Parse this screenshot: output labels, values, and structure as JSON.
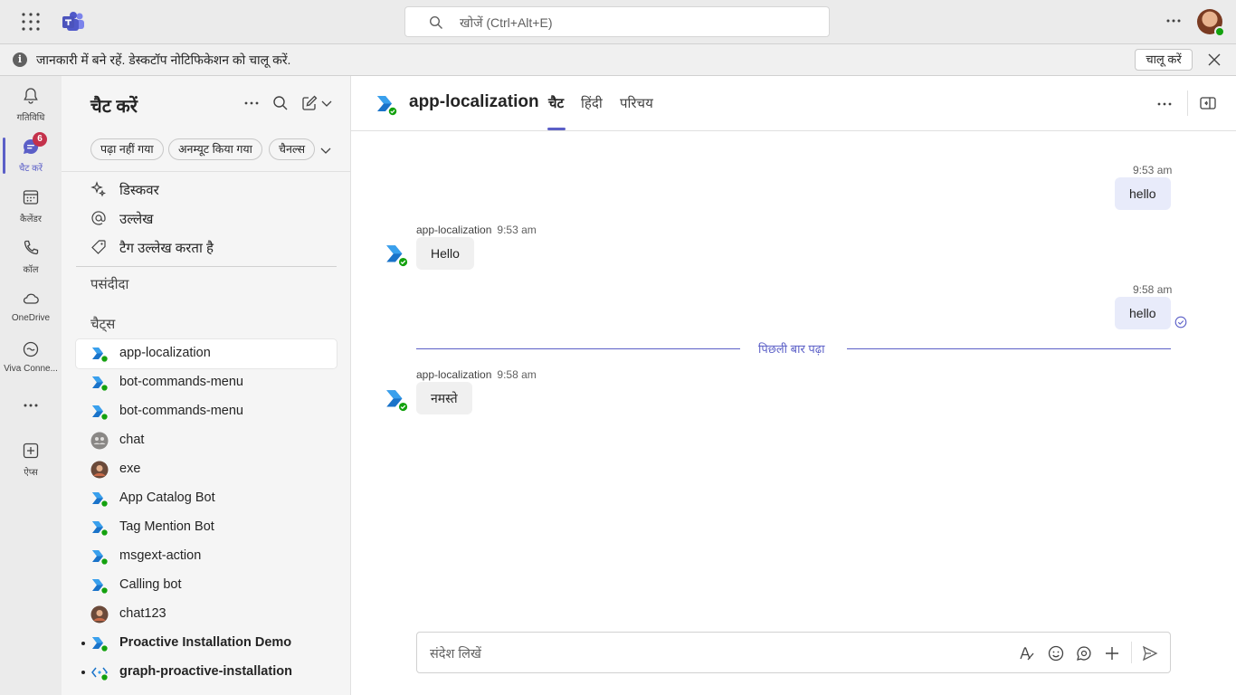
{
  "colors": {
    "brand": "#5b5fc7",
    "badge": "#c4314b",
    "presence": "#13a10e",
    "bubble_me": "#e8ebfa",
    "bubble_bot": "#f0f0f0"
  },
  "topbar": {
    "search_placeholder": "खोजें (Ctrl+Alt+E)"
  },
  "notification": {
    "text": "जानकारी में बने रहें. डेस्कटॉप नोटिफिकेशन को चालू करें.",
    "button": "चालू करें"
  },
  "rail": {
    "items": [
      {
        "label": "गतिविधि",
        "icon": "bell-icon"
      },
      {
        "label": "चैट करें",
        "icon": "chat-icon",
        "badge": "6"
      },
      {
        "label": "कैलेंडर",
        "icon": "calendar-icon"
      },
      {
        "label": "कॉल",
        "icon": "phone-icon"
      },
      {
        "label": "OneDrive",
        "icon": "cloud-icon"
      },
      {
        "label": "Viva Conne...",
        "icon": "viva-connections-icon"
      },
      {
        "label": "ऐप्स",
        "icon": "add-apps-icon"
      }
    ]
  },
  "chatlist": {
    "title": "चैट करें",
    "filters": [
      "पढ़ा नहीं गया",
      "अनम्यूट किया गया",
      "चैनल्स"
    ],
    "quick": [
      "डिस्कवर",
      "उल्लेख",
      "टैग उल्लेख करता है"
    ],
    "favorites_label": "पसंदीदा",
    "chats_label": "चैट्स",
    "chats": [
      {
        "name": "app-localization",
        "icon": "bot-icon"
      },
      {
        "name": "bot-commands-menu",
        "icon": "bot-icon"
      },
      {
        "name": "bot-commands-menu",
        "icon": "bot-icon"
      },
      {
        "name": "chat",
        "icon": "group-avatar-icon"
      },
      {
        "name": "exe",
        "icon": "person-avatar-icon"
      },
      {
        "name": "App Catalog Bot",
        "icon": "bot-icon"
      },
      {
        "name": "Tag Mention Bot",
        "icon": "bot-icon"
      },
      {
        "name": "msgext-action",
        "icon": "bot-icon"
      },
      {
        "name": "Calling bot",
        "icon": "bot-icon"
      },
      {
        "name": "chat123",
        "icon": "person-avatar-icon"
      },
      {
        "name": "Proactive Installation Demo",
        "icon": "bot-icon",
        "unread": true
      },
      {
        "name": "graph-proactive-installation",
        "icon": "code-bot-icon",
        "unread": true
      }
    ]
  },
  "conversation": {
    "title": "app-localization",
    "tabs": [
      "चैट",
      "हिंदी",
      "परिचय"
    ],
    "messages": [
      {
        "from": "me",
        "time": "9:53 am",
        "text": "hello"
      },
      {
        "from": "app-localization",
        "time": "9:53 am",
        "text": "Hello"
      },
      {
        "from": "me",
        "time": "9:58 am",
        "text": "hello"
      },
      {
        "from": "app-localization",
        "time": "9:58 am",
        "text": "नमस्ते"
      }
    ],
    "last_read": "पिछली बार पढ़ा",
    "compose_placeholder": "संदेश लिखें"
  }
}
